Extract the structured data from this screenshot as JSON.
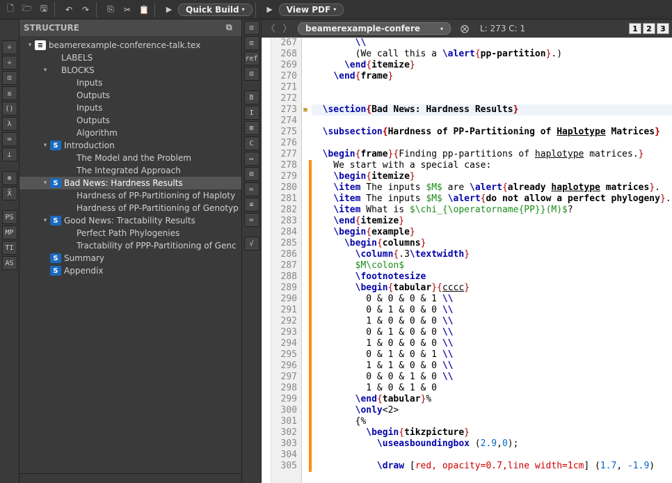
{
  "toolbar": {
    "quick_build": "Quick Build",
    "view_pdf": "View PDF"
  },
  "left_icons": [
    "÷",
    "÷",
    "⊡",
    "≤",
    "()",
    "λ",
    "∞",
    "⊥",
    "⊛",
    "X̂",
    "PS",
    "MP",
    "TI",
    "AS"
  ],
  "structure": {
    "title": "STRUCTURE",
    "tree": [
      {
        "depth": 0,
        "exp": "▾",
        "icon": "doc",
        "label": "beamerexample-conference-talk.tex"
      },
      {
        "depth": 1,
        "exp": "",
        "icon": "",
        "label": "LABELS"
      },
      {
        "depth": 1,
        "exp": "▾",
        "icon": "",
        "label": "BLOCKS"
      },
      {
        "depth": 2,
        "exp": "",
        "icon": "",
        "label": "Inputs"
      },
      {
        "depth": 2,
        "exp": "",
        "icon": "",
        "label": "Outputs"
      },
      {
        "depth": 2,
        "exp": "",
        "icon": "",
        "label": "Inputs"
      },
      {
        "depth": 2,
        "exp": "",
        "icon": "",
        "label": "Outputs"
      },
      {
        "depth": 2,
        "exp": "",
        "icon": "",
        "label": "Algorithm"
      },
      {
        "depth": 1,
        "exp": "▾",
        "icon": "s",
        "label": "Introduction"
      },
      {
        "depth": 2,
        "exp": "",
        "icon": "",
        "label": "The Model and the Problem"
      },
      {
        "depth": 2,
        "exp": "",
        "icon": "",
        "label": "The Integrated Approach"
      },
      {
        "depth": 1,
        "exp": "▾",
        "icon": "s",
        "label": "Bad News: Hardness Results",
        "selected": true
      },
      {
        "depth": 2,
        "exp": "",
        "icon": "",
        "label": "Hardness of PP-Partitioning of Haploty"
      },
      {
        "depth": 2,
        "exp": "",
        "icon": "",
        "label": "Hardness of PP-Partitioning of Genotyp"
      },
      {
        "depth": 1,
        "exp": "▾",
        "icon": "s",
        "label": "Good News: Tractability Results"
      },
      {
        "depth": 2,
        "exp": "",
        "icon": "",
        "label": "Perfect Path Phylogenies"
      },
      {
        "depth": 2,
        "exp": "",
        "icon": "",
        "label": "Tractability of PPP-Partitioning of Genc"
      },
      {
        "depth": 1,
        "exp": "",
        "icon": "s",
        "label": "Summary"
      },
      {
        "depth": 1,
        "exp": "",
        "icon": "s",
        "label": "Appendix"
      }
    ]
  },
  "mid_icons": [
    "⊡",
    "⊡",
    "ref",
    "⊡",
    "",
    "B",
    "I",
    "⊞",
    "C",
    "↦",
    "⊟",
    "≔",
    "≡",
    "≔",
    "",
    "√"
  ],
  "editor": {
    "tab_label": "beamerexample-confere",
    "position": "L: 273 C: 1",
    "col_boxes": [
      "1",
      "2",
      "3"
    ],
    "first_line": 267,
    "highlight_line": 273,
    "fold_marks": [
      273
    ],
    "orange_lines_from": 278,
    "lines": [
      {
        "n": 267,
        "segs": [
          [
            "        ",
            ""
          ],
          [
            "\\\\",
            "cmd"
          ]
        ]
      },
      {
        "n": 268,
        "segs": [
          [
            "        (We call this a ",
            ""
          ],
          [
            "\\alert",
            "cmd"
          ],
          [
            "{",
            "brace"
          ],
          [
            "pp-partition",
            "grp"
          ],
          [
            "}",
            "brace"
          ],
          [
            ".)",
            ""
          ]
        ]
      },
      {
        "n": 269,
        "segs": [
          [
            "      ",
            ""
          ],
          [
            "\\end",
            "cmd"
          ],
          [
            "{",
            "brace"
          ],
          [
            "itemize",
            "grp"
          ],
          [
            "}",
            "brace"
          ]
        ]
      },
      {
        "n": 270,
        "segs": [
          [
            "    ",
            ""
          ],
          [
            "\\end",
            "cmd"
          ],
          [
            "{",
            "brace"
          ],
          [
            "frame",
            "grp"
          ],
          [
            "}",
            "brace"
          ]
        ]
      },
      {
        "n": 271,
        "segs": [
          [
            "",
            ""
          ]
        ]
      },
      {
        "n": 272,
        "segs": [
          [
            "",
            ""
          ]
        ]
      },
      {
        "n": 273,
        "hl": true,
        "segs": [
          [
            "  ",
            ""
          ],
          [
            "\\section",
            "cmd bold"
          ],
          [
            "{",
            "brace bold"
          ],
          [
            "Bad News: Hardness Results",
            "grp bold"
          ],
          [
            "}",
            "brace bold"
          ]
        ]
      },
      {
        "n": 274,
        "segs": [
          [
            "",
            ""
          ]
        ]
      },
      {
        "n": 275,
        "segs": [
          [
            "  ",
            ""
          ],
          [
            "\\subsection",
            "cmd bold"
          ],
          [
            "{",
            "brace bold"
          ],
          [
            "Hardness of PP-Partitioning of ",
            "grp bold"
          ],
          [
            "Haplotype",
            "grp bold underl"
          ],
          [
            " Matrices",
            "grp bold"
          ],
          [
            "}",
            "brace bold"
          ]
        ]
      },
      {
        "n": 276,
        "segs": [
          [
            "",
            ""
          ]
        ]
      },
      {
        "n": 277,
        "segs": [
          [
            "  ",
            ""
          ],
          [
            "\\begin",
            "cmd"
          ],
          [
            "{",
            "brace"
          ],
          [
            "frame",
            "grp"
          ],
          [
            "}{",
            "brace"
          ],
          [
            "Finding pp-partitions of ",
            ""
          ],
          [
            "haplotype",
            "underl"
          ],
          [
            " matrices.",
            ""
          ],
          [
            "}",
            "brace"
          ]
        ]
      },
      {
        "n": 278,
        "segs": [
          [
            "    We start with a special case:",
            ""
          ]
        ]
      },
      {
        "n": 279,
        "segs": [
          [
            "    ",
            ""
          ],
          [
            "\\begin",
            "cmd"
          ],
          [
            "{",
            "brace"
          ],
          [
            "itemize",
            "grp"
          ],
          [
            "}",
            "brace"
          ]
        ]
      },
      {
        "n": 280,
        "segs": [
          [
            "    ",
            ""
          ],
          [
            "\\item",
            "cmd"
          ],
          [
            " The inputs ",
            ""
          ],
          [
            "$M$",
            "math"
          ],
          [
            " are ",
            ""
          ],
          [
            "\\alert",
            "cmd"
          ],
          [
            "{",
            "brace"
          ],
          [
            "already ",
            "grp"
          ],
          [
            "haplotype",
            "grp underl"
          ],
          [
            " matrices",
            "grp"
          ],
          [
            "}",
            "brace"
          ],
          [
            ".",
            ""
          ]
        ]
      },
      {
        "n": 281,
        "segs": [
          [
            "    ",
            ""
          ],
          [
            "\\item",
            "cmd"
          ],
          [
            " The inputs ",
            ""
          ],
          [
            "$M$",
            "math"
          ],
          [
            " ",
            ""
          ],
          [
            "\\alert",
            "cmd"
          ],
          [
            "{",
            "brace"
          ],
          [
            "do not allow a perfect phylogeny",
            "grp"
          ],
          [
            "}",
            "brace"
          ],
          [
            ".",
            ""
          ]
        ]
      },
      {
        "n": 282,
        "segs": [
          [
            "    ",
            ""
          ],
          [
            "\\item",
            "cmd"
          ],
          [
            " What is ",
            ""
          ],
          [
            "$\\chi_{\\operatorname{PP}}(M)$",
            "math"
          ],
          [
            "?",
            ""
          ]
        ]
      },
      {
        "n": 283,
        "segs": [
          [
            "    ",
            ""
          ],
          [
            "\\end",
            "cmd"
          ],
          [
            "{",
            "brace"
          ],
          [
            "itemize",
            "grp"
          ],
          [
            "}",
            "brace"
          ]
        ]
      },
      {
        "n": 284,
        "segs": [
          [
            "    ",
            ""
          ],
          [
            "\\begin",
            "cmd"
          ],
          [
            "{",
            "brace"
          ],
          [
            "example",
            "grp"
          ],
          [
            "}",
            "brace"
          ]
        ]
      },
      {
        "n": 285,
        "segs": [
          [
            "      ",
            ""
          ],
          [
            "\\begin",
            "cmd"
          ],
          [
            "{",
            "brace"
          ],
          [
            "columns",
            "grp"
          ],
          [
            "}",
            "brace"
          ]
        ]
      },
      {
        "n": 286,
        "segs": [
          [
            "        ",
            ""
          ],
          [
            "\\column",
            "cmd"
          ],
          [
            "{",
            "brace"
          ],
          [
            ".3",
            ""
          ],
          [
            "\\textwidth",
            "cmd"
          ],
          [
            "}",
            "brace"
          ]
        ]
      },
      {
        "n": 287,
        "segs": [
          [
            "        ",
            ""
          ],
          [
            "$M\\colon$",
            "math"
          ]
        ]
      },
      {
        "n": 288,
        "segs": [
          [
            "        ",
            ""
          ],
          [
            "\\footnotesize",
            "cmd"
          ]
        ]
      },
      {
        "n": 289,
        "segs": [
          [
            "        ",
            ""
          ],
          [
            "\\begin",
            "cmd"
          ],
          [
            "{",
            "brace"
          ],
          [
            "tabular",
            "grp"
          ],
          [
            "}{",
            "brace"
          ],
          [
            "cccc",
            "underl"
          ],
          [
            "}",
            "brace"
          ]
        ]
      },
      {
        "n": 290,
        "segs": [
          [
            "          0 & 0 & 0 & 1 ",
            ""
          ],
          [
            "\\\\",
            "cmd"
          ]
        ]
      },
      {
        "n": 291,
        "segs": [
          [
            "          0 & 1 & 0 & 0 ",
            ""
          ],
          [
            "\\\\",
            "cmd"
          ]
        ]
      },
      {
        "n": 292,
        "segs": [
          [
            "          1 & 0 & 0 & 0 ",
            ""
          ],
          [
            "\\\\",
            "cmd"
          ]
        ]
      },
      {
        "n": 293,
        "segs": [
          [
            "          0 & 1 & 0 & 0 ",
            ""
          ],
          [
            "\\\\",
            "cmd"
          ]
        ]
      },
      {
        "n": 294,
        "segs": [
          [
            "          1 & 0 & 0 & 0 ",
            ""
          ],
          [
            "\\\\",
            "cmd"
          ]
        ]
      },
      {
        "n": 295,
        "segs": [
          [
            "          0 & 1 & 0 & 1 ",
            ""
          ],
          [
            "\\\\",
            "cmd"
          ]
        ]
      },
      {
        "n": 296,
        "segs": [
          [
            "          1 & 1 & 0 & 0 ",
            ""
          ],
          [
            "\\\\",
            "cmd"
          ]
        ]
      },
      {
        "n": 297,
        "segs": [
          [
            "          0 & 0 & 1 & 0 ",
            ""
          ],
          [
            "\\\\",
            "cmd"
          ]
        ]
      },
      {
        "n": 298,
        "segs": [
          [
            "          1 & 0 & 1 & 0 ",
            ""
          ]
        ]
      },
      {
        "n": 299,
        "segs": [
          [
            "        ",
            ""
          ],
          [
            "\\end",
            "cmd"
          ],
          [
            "{",
            "brace"
          ],
          [
            "tabular",
            "grp"
          ],
          [
            "}",
            "brace"
          ],
          [
            "%",
            ""
          ]
        ]
      },
      {
        "n": 300,
        "segs": [
          [
            "        ",
            ""
          ],
          [
            "\\only",
            "cmd"
          ],
          [
            "<2>",
            ""
          ]
        ]
      },
      {
        "n": 301,
        "segs": [
          [
            "        {%",
            ""
          ]
        ]
      },
      {
        "n": 302,
        "segs": [
          [
            "          ",
            ""
          ],
          [
            "\\begin",
            "cmd"
          ],
          [
            "{",
            "brace"
          ],
          [
            "tikzpicture",
            "grp"
          ],
          [
            "}",
            "brace"
          ]
        ]
      },
      {
        "n": 303,
        "segs": [
          [
            "            ",
            ""
          ],
          [
            "\\useasboundingbox",
            "cmd"
          ],
          [
            " (",
            ""
          ],
          [
            "2.9",
            "num"
          ],
          [
            ",",
            ""
          ],
          [
            "0",
            "num"
          ],
          [
            ");",
            ""
          ]
        ]
      },
      {
        "n": 304,
        "segs": [
          [
            "",
            ""
          ]
        ]
      },
      {
        "n": 305,
        "segs": [
          [
            "            ",
            ""
          ],
          [
            "\\draw",
            "cmd"
          ],
          [
            " [",
            ""
          ],
          [
            "red, opacity=0.7,line width=1cm",
            "red"
          ],
          [
            "] (",
            ""
          ],
          [
            "1.7",
            "num"
          ],
          [
            ", ",
            ""
          ],
          [
            "-1.9",
            "num"
          ],
          [
            ")",
            ""
          ]
        ]
      }
    ]
  }
}
